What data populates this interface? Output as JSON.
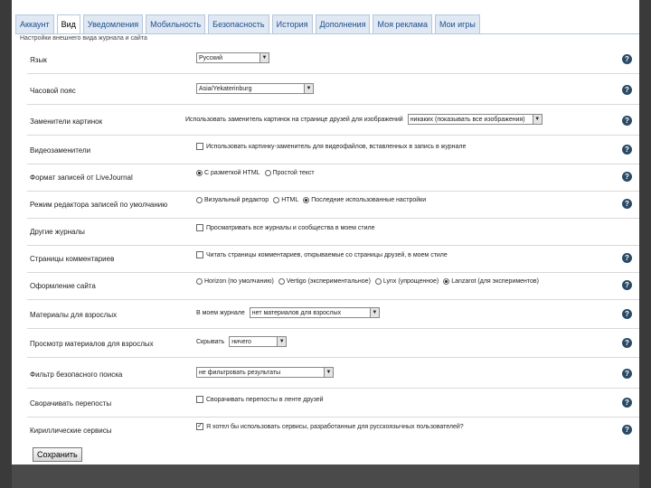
{
  "tabs": [
    "Аккаунт",
    "Вид",
    "Уведомления",
    "Мобильность",
    "Безопасность",
    "История",
    "Дополнения",
    "Моя реклама",
    "Мои игры"
  ],
  "active_tab": 1,
  "breadcrumb": "Настройки внешнего вида журнала и сайта",
  "rows": {
    "language": {
      "label": "Язык",
      "value": "Русский"
    },
    "timezone": {
      "label": "Часовой пояс",
      "value": "Asia/Yekaterinburg"
    },
    "image_placeholders": {
      "label": "Заменители картинок",
      "text": "Использовать заменитель картинок на странице друзей для изображений",
      "value": "никаких (показывать все изображения)"
    },
    "video_placeholders": {
      "label": "Видеозаменители",
      "text": "Использовать картинку-заменитель для видеофайлов, вставленных в запись в журнале"
    },
    "post_format": {
      "label": "Формат записей от LiveJournal",
      "options": [
        "С разметкой HTML",
        "Простой текст"
      ]
    },
    "editor_mode": {
      "label": "Режим редактора записей по умолчанию",
      "options": [
        "Визуальный редактор",
        "HTML",
        "Последние использованные настройки"
      ]
    },
    "other_journals": {
      "label": "Другие журналы",
      "text": "Просматривать все журналы и сообщества в моем стиле"
    },
    "comment_pages": {
      "label": "Страницы комментариев",
      "text": "Читать страницы комментариев, открываемые со страницы друзей, в моем стиле"
    },
    "site_theme": {
      "label": "Оформление сайта",
      "options": [
        "Horizon (по умолчанию)",
        "Vertigo (экспериментальное)",
        "Lynx (упрощенное)",
        "Lanzarot (для экспериментов)"
      ]
    },
    "adult_content": {
      "label": "Материалы для взрослых",
      "prefix": "В моем журнале",
      "value": "нет материалов для взрослых"
    },
    "adult_view": {
      "label": "Просмотр материалов для взрослых",
      "prefix": "Скрывать",
      "value": "ничего"
    },
    "safe_search": {
      "label": "Фильтр безопасного поиска",
      "value": "не фильтровать результаты"
    },
    "collapse_reposts": {
      "label": "Сворачивать перепосты",
      "text": "Сворачивать перепосты в ленте друзей"
    },
    "cyrillic": {
      "label": "Кириллические сервисы",
      "text": "Я хотел бы использовать сервисы, разработанные для русскоязычных пользователей?"
    }
  },
  "help_glyph": "?",
  "save_label": "Сохранить",
  "colors": {
    "tab_bg": "#dfe8f3",
    "help_icon": "#2c4a66",
    "link": "#1f4e8c"
  }
}
